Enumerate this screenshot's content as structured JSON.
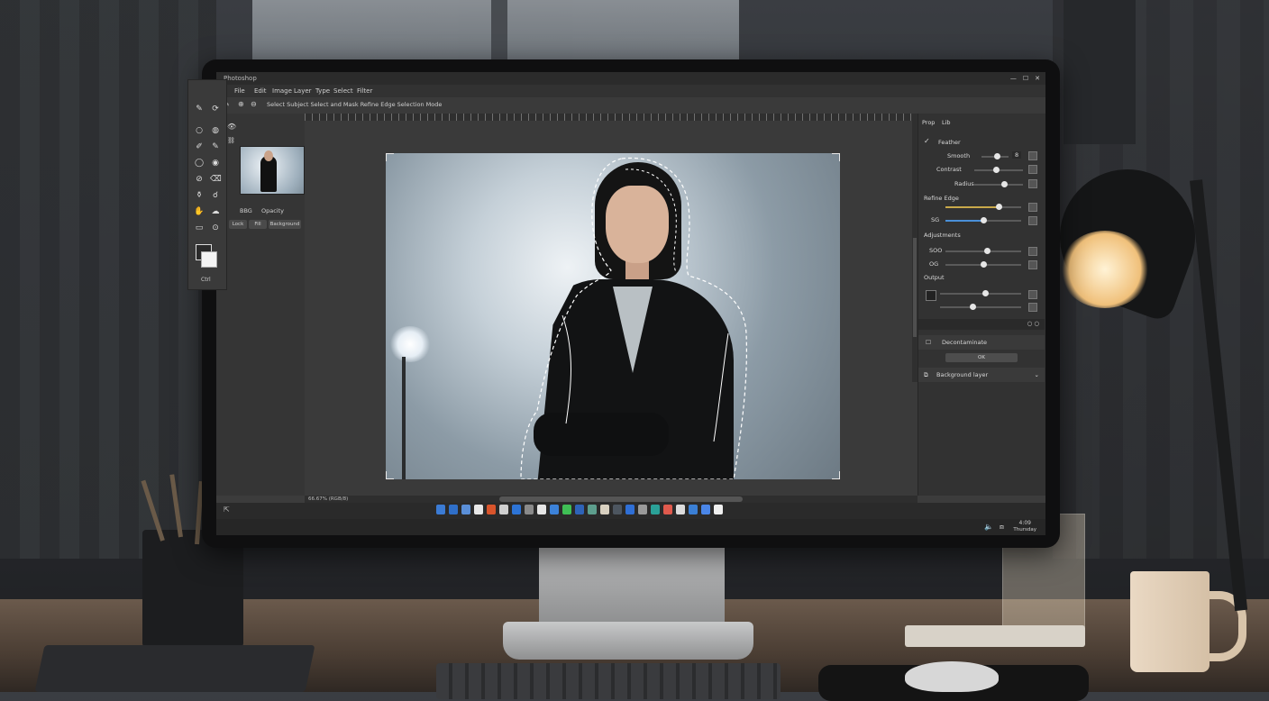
{
  "app": {
    "title": "Photoshop"
  },
  "window_controls": {
    "minimize": "—",
    "maximize": "☐",
    "close": "✕"
  },
  "menu": [
    "File",
    "Edit",
    "Image",
    "Layer",
    "Type",
    "Select",
    "Filter"
  ],
  "options_bar": {
    "text": "Select Subject   Select and Mask   Refine Edge   Selection Mode"
  },
  "layers_panel": {
    "labels": [
      "BBG",
      "Opacity"
    ],
    "buttons": [
      "Lock",
      "Fill",
      "Background"
    ]
  },
  "tools_panel": {
    "footer": "Ctrl"
  },
  "canvas": {
    "zoom_label": "66.67% (RGB/8)"
  },
  "properties": {
    "tabs": [
      "Prop",
      "Lib"
    ],
    "feather": {
      "title": "Feather",
      "value": "8"
    },
    "rows": [
      {
        "label": "Smooth",
        "value": 0.55
      },
      {
        "label": "Contrast",
        "value": 0.45
      },
      {
        "label": "Radius",
        "value": 0.62
      }
    ],
    "refine_edge": {
      "title": "Refine Edge",
      "label": "SG",
      "slider1": 0.7,
      "slider2": 0.5
    },
    "adjustments": {
      "title": "Adjustments",
      "row1_label": "SOO",
      "row1": 0.55,
      "row2_label": "OG",
      "row2": 0.5
    },
    "output": {
      "title": "Output",
      "slider1": 0.55,
      "slider2": 0.4
    },
    "decontaminate": {
      "label": "Decontaminate"
    },
    "ok_button": "OK",
    "background_layer": "Background layer"
  },
  "status": {
    "time": "4:09",
    "date": "Thursday"
  },
  "accent_color": "#4a90d9",
  "highlight_color": "#c9a94a"
}
